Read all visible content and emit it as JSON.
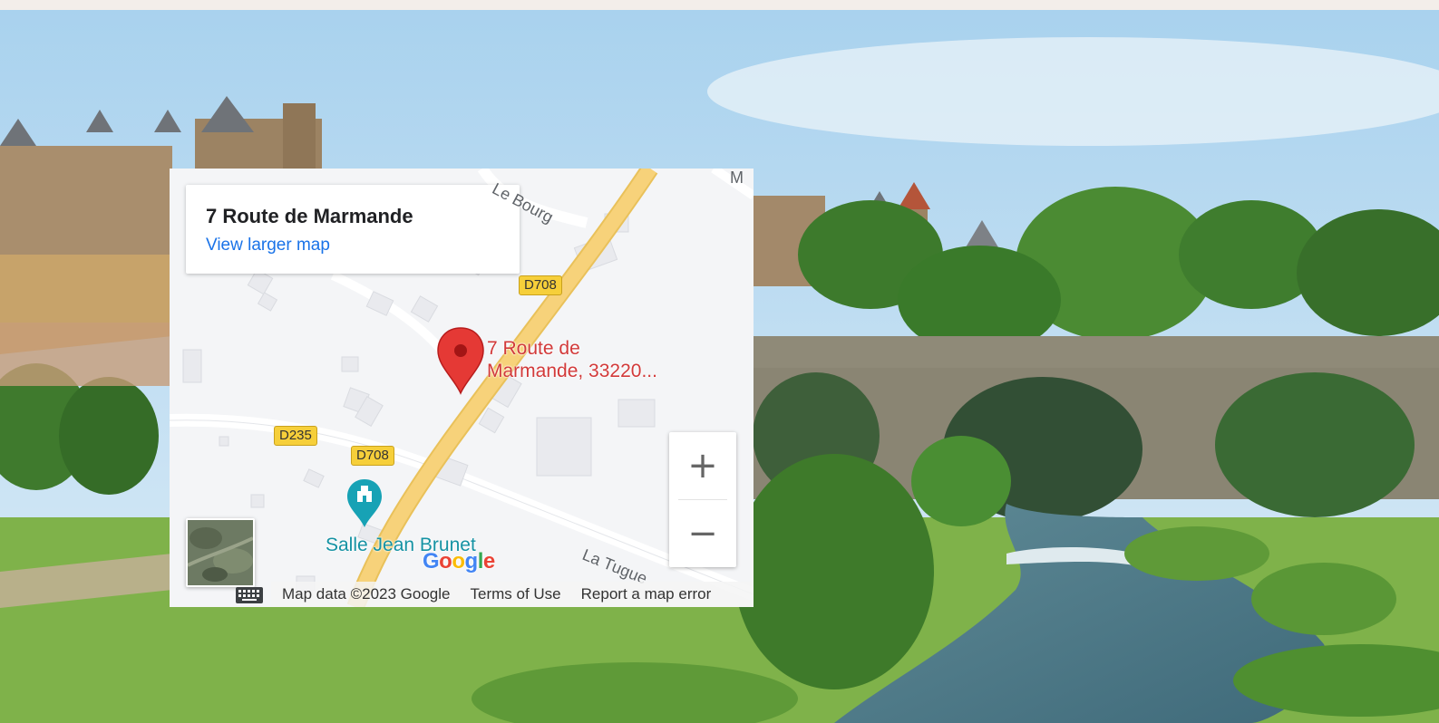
{
  "map": {
    "place_title": "7 Route de Marmande",
    "view_larger_link": "View larger map",
    "pin_label_line1": "7 Route de",
    "pin_label_line2": "Marmande, 33220...",
    "poi_label": "Salle Jean Brunet",
    "road_labels": {
      "bourg": "Le Bourg",
      "tuguet": "La Tugue",
      "partial_m": "M"
    },
    "road_shields": {
      "d708_north": "D708",
      "d235": "D235",
      "d708_south": "D708"
    },
    "zoom_in_label": "+",
    "zoom_out_label": "−",
    "logo_text": "Google",
    "footer": {
      "map_data": "Map data ©2023 Google",
      "terms": "Terms of Use",
      "report": "Report a map error"
    },
    "colors": {
      "pin": "#e53935",
      "link": "#1a73e8",
      "road": "#f7d27a",
      "poi": "#1592a3"
    }
  },
  "icons": [
    "map-pin-icon",
    "poi-landmark-icon",
    "keyboard-icon",
    "satellite-thumbnail"
  ]
}
